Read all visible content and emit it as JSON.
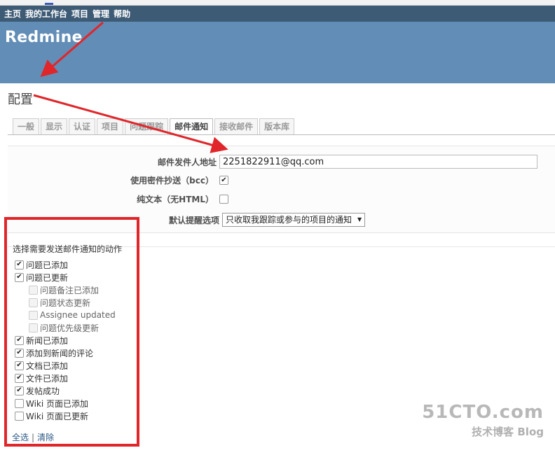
{
  "topmenu": {
    "items": [
      "主页",
      "我的工作台",
      "项目",
      "管理",
      "帮助"
    ]
  },
  "header": {
    "title": "Redmine"
  },
  "page": {
    "title": "配置"
  },
  "tabs": [
    {
      "label": "一般",
      "selected": false
    },
    {
      "label": "显示",
      "selected": false
    },
    {
      "label": "认证",
      "selected": false
    },
    {
      "label": "项目",
      "selected": false
    },
    {
      "label": "问题跟踪",
      "selected": false
    },
    {
      "label": "邮件通知",
      "selected": true
    },
    {
      "label": "接收邮件",
      "selected": false
    },
    {
      "label": "版本库",
      "selected": false
    }
  ],
  "settings": {
    "emission_label": "邮件发件人地址",
    "emission_value": "2251822911@qq.com",
    "bcc_label": "使用密件抄送（bcc）",
    "bcc_checked": true,
    "plain_label": "纯文本（无HTML）",
    "plain_checked": false,
    "default_label": "默认提醒选项",
    "default_value": "只收取我跟踪或参与的项目的通知"
  },
  "notifications": {
    "title": "选择需要发送邮件通知的动作",
    "items": [
      {
        "label": "问题已添加",
        "checked": true,
        "sub": false,
        "disabled": false
      },
      {
        "label": "问题已更新",
        "checked": true,
        "sub": false,
        "disabled": false
      },
      {
        "label": "问题备注已添加",
        "checked": false,
        "sub": true,
        "disabled": true
      },
      {
        "label": "问题状态更新",
        "checked": false,
        "sub": true,
        "disabled": true
      },
      {
        "label": "Assignee updated",
        "checked": false,
        "sub": true,
        "disabled": true
      },
      {
        "label": "问题优先级更新",
        "checked": false,
        "sub": true,
        "disabled": true
      },
      {
        "label": "新闻已添加",
        "checked": true,
        "sub": false,
        "disabled": false
      },
      {
        "label": "添加到新闻的评论",
        "checked": true,
        "sub": false,
        "disabled": false
      },
      {
        "label": "文档已添加",
        "checked": true,
        "sub": false,
        "disabled": false
      },
      {
        "label": "文件已添加",
        "checked": true,
        "sub": false,
        "disabled": false
      },
      {
        "label": "发帖成功",
        "checked": true,
        "sub": false,
        "disabled": false
      },
      {
        "label": "Wiki 页面已添加",
        "checked": false,
        "sub": false,
        "disabled": false
      },
      {
        "label": "Wiki 页面已更新",
        "checked": false,
        "sub": false,
        "disabled": false
      }
    ],
    "select_all": "全选",
    "separator": "|",
    "clear": "清除"
  },
  "watermark": {
    "site": "51CTO.com",
    "sub": "技术博客",
    "blog": "Blog"
  },
  "colors": {
    "header": "#628db6",
    "topmenu": "#3e5b76",
    "annotation": "#e0262a",
    "link": "#2a5685"
  }
}
